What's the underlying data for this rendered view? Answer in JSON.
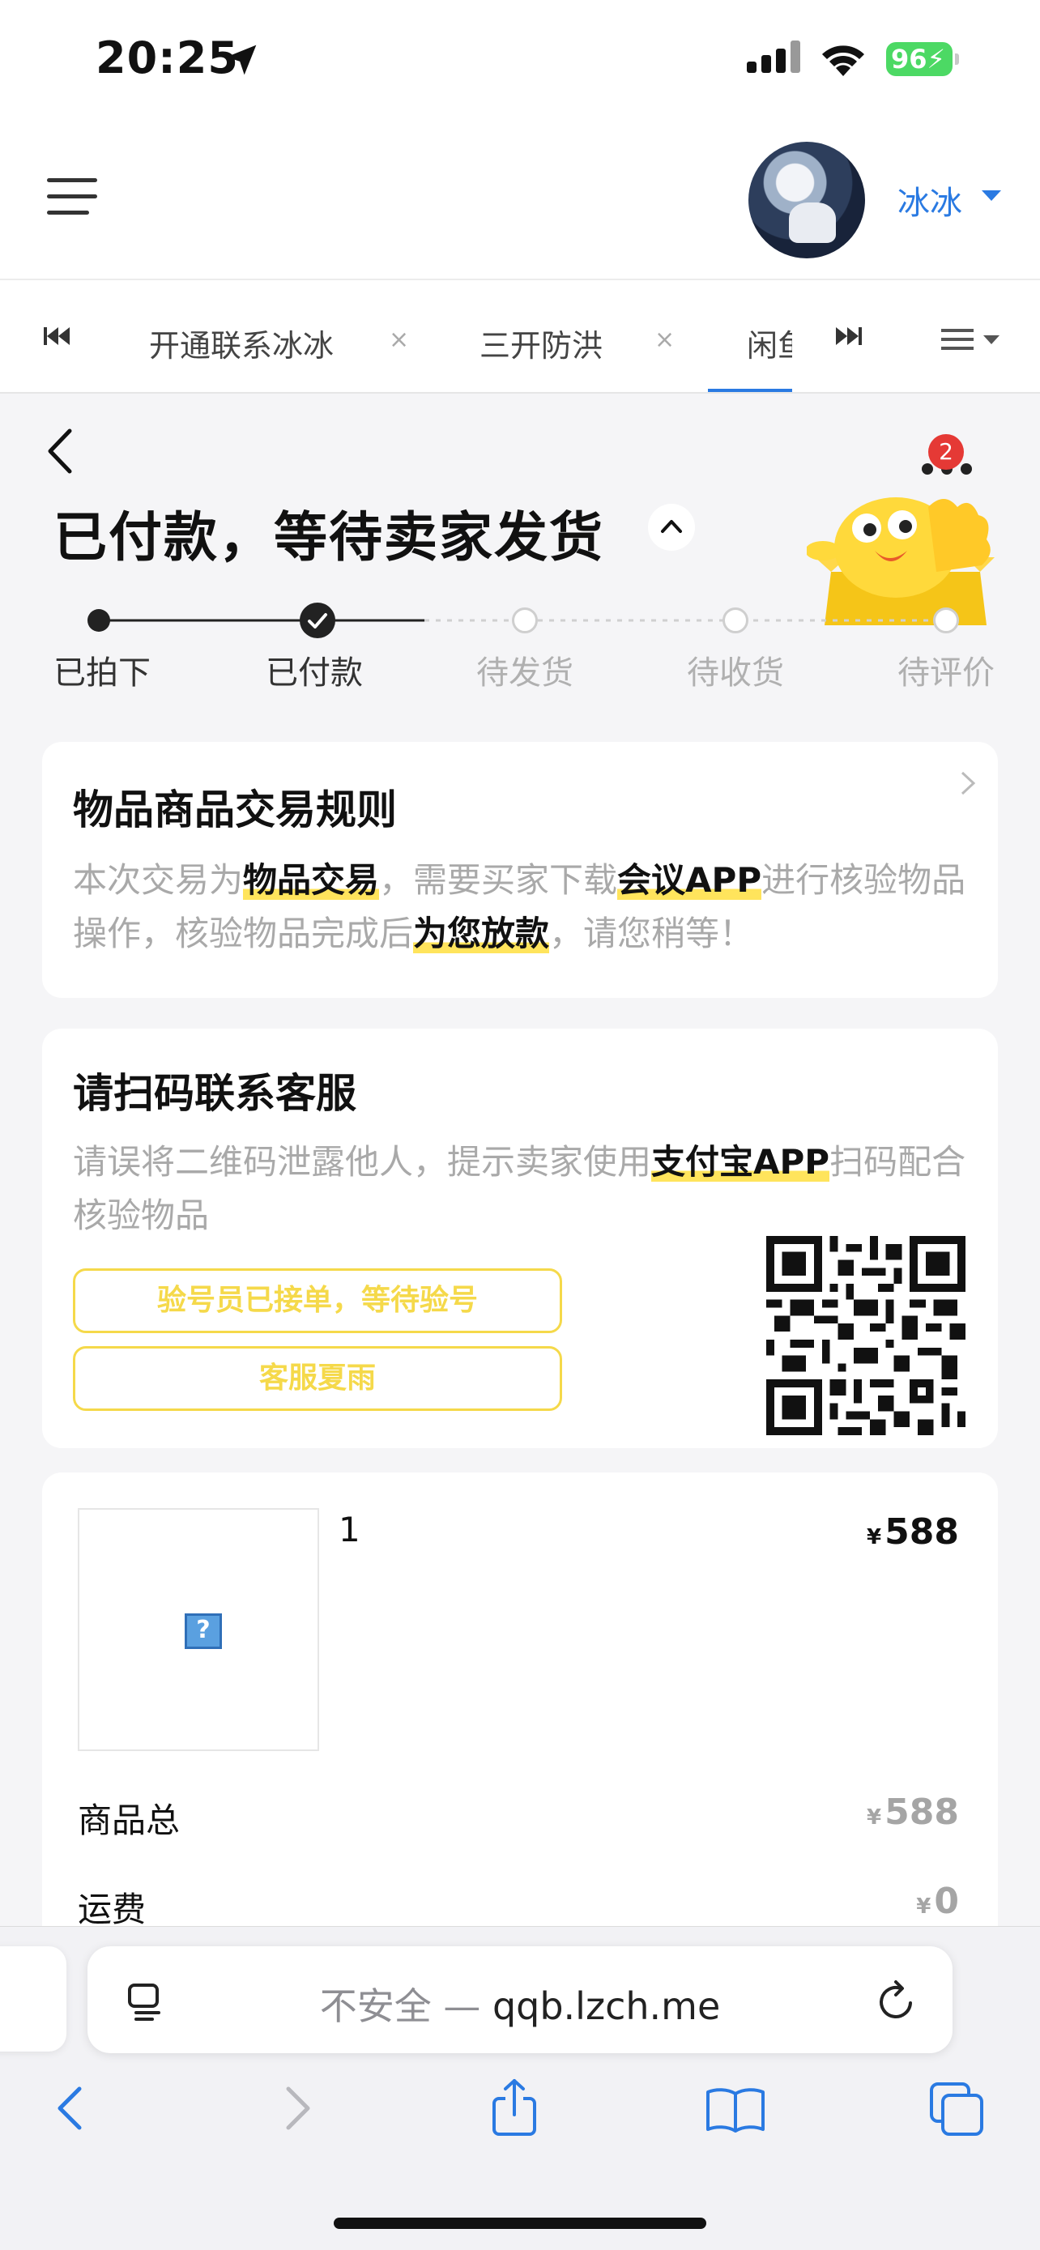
{
  "status_bar": {
    "time": "20:25",
    "battery": "96"
  },
  "header": {
    "username": "冰冰"
  },
  "tabs": [
    {
      "label": "开通联系冰冰",
      "closable": true
    },
    {
      "label": "三开防洪",
      "closable": true
    },
    {
      "label": "闲鱼",
      "active": true
    }
  ],
  "order": {
    "title": "已付款，等待卖家发货",
    "notification_count": "2",
    "steps": [
      {
        "label": "已拍下",
        "state": "done"
      },
      {
        "label": "已付款",
        "state": "current"
      },
      {
        "label": "待发货",
        "state": "pending"
      },
      {
        "label": "待收货",
        "state": "pending"
      },
      {
        "label": "待评价",
        "state": "pending"
      }
    ]
  },
  "rules_card": {
    "title": "物品商品交易规则",
    "text_1": "本次交易为",
    "hl_1": "物品交易",
    "text_2": "，需要买家下载",
    "hl_2": "会议APP",
    "text_3": "进行核验物品操作，核验物品完成后",
    "hl_3": "为您放款",
    "text_4": "，请您稍等！"
  },
  "service_card": {
    "title": "请扫码联系客服",
    "text_1": "请误将二维码泄露他人，提示卖家使用",
    "hl_1": "支付宝APP",
    "text_2": "扫码配合核验物品",
    "button_1": "验号员已接单，等待验号",
    "button_2": "客服夏雨"
  },
  "product_card": {
    "name": "1",
    "price_symbol": "¥",
    "price": "588",
    "rows": [
      {
        "label": "商品总",
        "value": "588"
      },
      {
        "label": "运费",
        "value": "0"
      }
    ]
  },
  "browser": {
    "insecure_label": "不安全",
    "separator": "—",
    "domain": "qqb.lzch.me"
  },
  "colors": {
    "accent_blue": "#2a7ae2",
    "highlight_yellow": "#ffe45c",
    "button_yellow": "#f5d94a",
    "badge_red": "#e53935"
  }
}
